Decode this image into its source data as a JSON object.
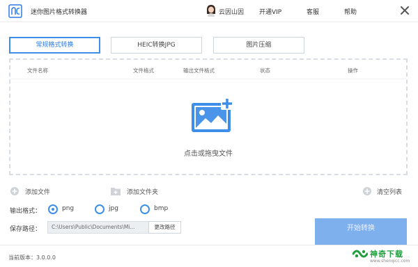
{
  "titlebar": {
    "app_title": "迷你图片格式转换器",
    "user_name": "云因山因",
    "vip_label": "开通VIP",
    "service_label": "客服",
    "help_label": "帮助"
  },
  "tabs": [
    {
      "label": "常规格式转换",
      "active": true
    },
    {
      "label": "HEIC转换JPG",
      "active": false
    },
    {
      "label": "图片压缩",
      "active": false
    }
  ],
  "table": {
    "columns": [
      "文件名称",
      "文件格式",
      "输出文件格式",
      "状态",
      "操作"
    ]
  },
  "dropzone": {
    "hint": "点击或拖曳文件"
  },
  "actions": {
    "add_file": "添加文件",
    "add_folder": "添加文件夹",
    "clear_list": "清空列表"
  },
  "output_format": {
    "label": "输出格式：",
    "options": [
      "png",
      "jpg",
      "bmp"
    ],
    "selected": "png"
  },
  "save_path": {
    "label": "保存路径：",
    "value": "C:\\Users\\Public\\Documents\\Mi...",
    "change_button": "更改路径"
  },
  "start_button": "开始转换",
  "status": {
    "version": "当前版本：3.0.0.0"
  },
  "watermark": {
    "text": "神奇下载",
    "url": "www.shenqicc.com"
  },
  "colors": {
    "accent": "#3d8ee8",
    "start_button": "#7fb0ee",
    "watermark": "#1f9e3c"
  }
}
